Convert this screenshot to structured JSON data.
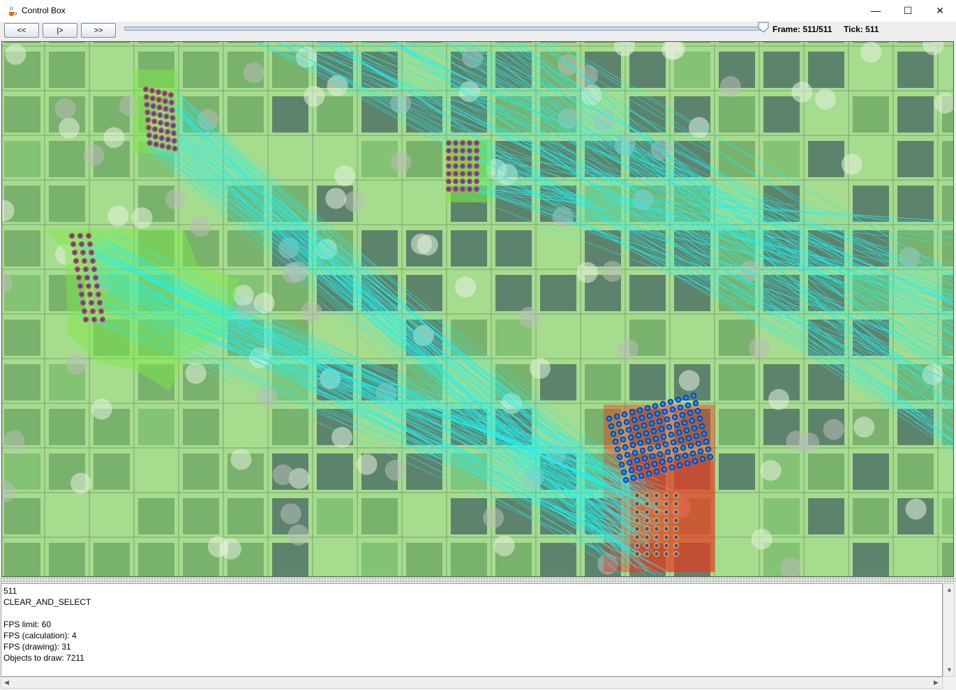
{
  "window": {
    "title": "Control Box",
    "minimize_glyph": "—",
    "maximize_glyph": "☐",
    "close_glyph": "✕",
    "icon": "java-cup-icon"
  },
  "toolbar": {
    "rewind_label": "<<",
    "play_label": "|>",
    "forward_label": ">>",
    "frame_label": "Frame: 511/511",
    "tick_label": "Tick: 511",
    "slider_position": 1.0
  },
  "colors": {
    "field": "#a6dc8e",
    "building": "#5a7d6c",
    "lines": "#22f0f0",
    "team_a": "#7de84a",
    "team_b": "#e83a22"
  },
  "console": {
    "lines": [
      "511",
      "CLEAR_AND_SELECT",
      "",
      "FPS limit: 60",
      "FPS (calculation): 4",
      "FPS (drawing): 31",
      "Objects to draw: 7211"
    ]
  },
  "scrollbars": {
    "up_glyph": "▲",
    "down_glyph": "▼",
    "left_glyph": "◀",
    "right_glyph": "▶"
  }
}
